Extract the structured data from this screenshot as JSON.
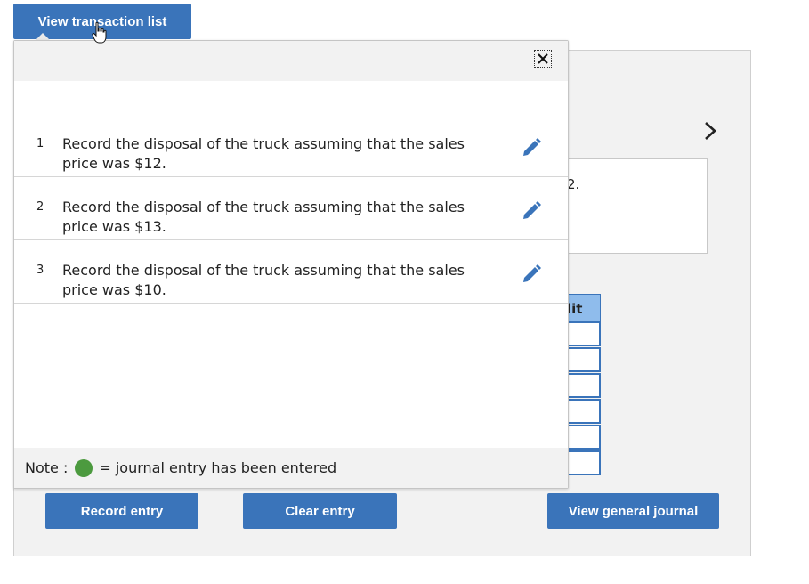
{
  "top_button": {
    "label": "View transaction list"
  },
  "popup": {
    "close_symbol": "✕",
    "transactions": [
      {
        "number": "1",
        "text": "Record the disposal of the truck assuming that the sales price was $12."
      },
      {
        "number": "2",
        "text": "Record the disposal of the truck assuming that the sales price was $13."
      },
      {
        "number": "3",
        "text": "Record the disposal of the truck assuming that the sales price was $10."
      }
    ],
    "note": {
      "label": "Note :",
      "text": "= journal entry has been entered",
      "dot_color": "#4c9a3f"
    }
  },
  "background": {
    "text_fragment": "2.",
    "table_header_fragment": "lit",
    "chevron": "›"
  },
  "bottom_buttons": {
    "record_entry": "Record entry",
    "clear_entry": "Clear entry",
    "view_general_journal": "View general journal"
  },
  "colors": {
    "accent": "#3a74ba",
    "header_blue": "#8fbcec",
    "panel_gray": "#f2f2f2",
    "entered_green": "#4c9a3f"
  }
}
